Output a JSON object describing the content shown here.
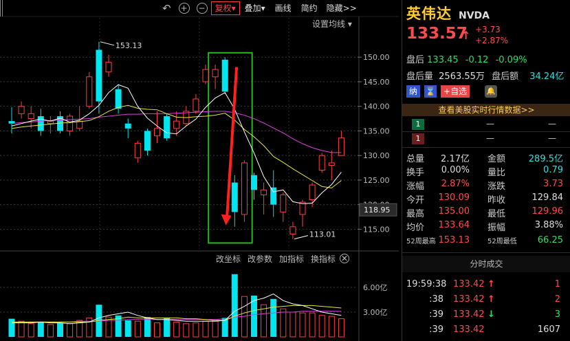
{
  "toolbar": {
    "undo_icon": "undo-icon",
    "zoom_in_icon": "plus-icon",
    "zoom_out_icon": "minus-icon",
    "fuquan": "复权▾",
    "diejia": "叠加▾",
    "huaxian": "画线",
    "jianyue": "简约",
    "yincang": "隐藏>>"
  },
  "ma_setting": "设置均线 ▾",
  "annotations": {
    "high": "153.13",
    "low": "113.01"
  },
  "y_axis": {
    "ticks": [
      {
        "label": "150.00",
        "value": 150
      },
      {
        "label": "145.00",
        "value": 145
      },
      {
        "label": "140.00",
        "value": 140
      },
      {
        "label": "135.00",
        "value": 135
      },
      {
        "label": "130.00",
        "value": 130
      },
      {
        "label": "125.00",
        "value": 125
      },
      {
        "label": "120.00",
        "value": 120
      },
      {
        "label": "115.00",
        "value": 115
      }
    ],
    "current_marker": "118.95"
  },
  "volume_axis": {
    "ticks": [
      {
        "label": "6.00亿",
        "value": 6
      },
      {
        "label": "3.00亿",
        "value": 3
      }
    ]
  },
  "sub_toolbar": {
    "gai_zuobiao": "改坐标",
    "gai_canshu": "改参数",
    "jia_zhibiao": "加指标",
    "huan_zhibiao": "换指标"
  },
  "chart_data": {
    "type": "candlestick",
    "ylim": [
      111,
      158
    ],
    "volume_ylim": [
      0,
      8.5
    ],
    "colors": {
      "up": "#ff4040",
      "down": "#00e5ee",
      "ma5": "#ffffff",
      "ma10": "#e8e838",
      "ma20": "#e040e0",
      "highlight": "#22bb22",
      "arrow": "#ff2020"
    },
    "candles": [
      {
        "o": 137.0,
        "h": 139.8,
        "l": 134.5,
        "c": 136.5,
        "v": 2.2
      },
      {
        "o": 138.5,
        "h": 141.0,
        "l": 137.5,
        "c": 140.0,
        "v": 1.9
      },
      {
        "o": 137.5,
        "h": 140.0,
        "l": 135.5,
        "c": 138.5,
        "v": 1.6
      },
      {
        "o": 138.0,
        "h": 139.5,
        "l": 134.0,
        "c": 135.0,
        "v": 1.8
      },
      {
        "o": 136.5,
        "h": 138.0,
        "l": 134.5,
        "c": 137.0,
        "v": 1.5
      },
      {
        "o": 138.0,
        "h": 139.0,
        "l": 134.5,
        "c": 135.0,
        "v": 1.7
      },
      {
        "o": 135.0,
        "h": 138.5,
        "l": 134.0,
        "c": 138.0,
        "v": 1.6
      },
      {
        "o": 135.5,
        "h": 140.0,
        "l": 135.0,
        "c": 137.0,
        "v": 2.0
      },
      {
        "o": 140.0,
        "h": 147.0,
        "l": 139.5,
        "c": 146.0,
        "v": 2.3
      },
      {
        "o": 151.5,
        "h": 153.13,
        "l": 138.5,
        "c": 141.0,
        "v": 3.9
      },
      {
        "o": 147.0,
        "h": 150.5,
        "l": 146.0,
        "c": 149.0,
        "v": 2.4
      },
      {
        "o": 143.5,
        "h": 144.5,
        "l": 138.5,
        "c": 139.5,
        "v": 2.6
      },
      {
        "o": 136.5,
        "h": 137.5,
        "l": 133.5,
        "c": 135.5,
        "v": 2.0
      },
      {
        "o": 129.5,
        "h": 133.0,
        "l": 128.5,
        "c": 132.5,
        "v": 1.9
      },
      {
        "o": 135.0,
        "h": 135.5,
        "l": 130.0,
        "c": 131.0,
        "v": 2.4
      },
      {
        "o": 134.0,
        "h": 139.0,
        "l": 132.5,
        "c": 135.5,
        "v": 1.7
      },
      {
        "o": 138.0,
        "h": 138.5,
        "l": 133.0,
        "c": 133.5,
        "v": 2.3
      },
      {
        "o": 135.5,
        "h": 139.0,
        "l": 134.0,
        "c": 137.0,
        "v": 1.8
      },
      {
        "o": 136.5,
        "h": 140.0,
        "l": 136.0,
        "c": 139.0,
        "v": 1.6
      },
      {
        "o": 139.0,
        "h": 142.5,
        "l": 138.5,
        "c": 141.5,
        "v": 1.7
      },
      {
        "o": 145.0,
        "h": 148.5,
        "l": 144.5,
        "c": 147.5,
        "v": 1.9
      },
      {
        "o": 146.0,
        "h": 148.5,
        "l": 143.5,
        "c": 147.5,
        "v": 2.0
      },
      {
        "o": 149.5,
        "h": 150.0,
        "l": 142.5,
        "c": 143.0,
        "v": 2.3
      },
      {
        "o": 124.5,
        "h": 126.0,
        "l": 115.5,
        "c": 118.5,
        "v": 7.6
      },
      {
        "o": 118.0,
        "h": 129.0,
        "l": 116.5,
        "c": 128.5,
        "v": 4.9
      },
      {
        "o": 126.0,
        "h": 126.5,
        "l": 121.0,
        "c": 123.0,
        "v": 5.0
      },
      {
        "o": 122.0,
        "h": 124.5,
        "l": 118.0,
        "c": 123.0,
        "v": 3.9
      },
      {
        "o": 123.5,
        "h": 127.0,
        "l": 117.5,
        "c": 120.0,
        "v": 4.6
      },
      {
        "o": 118.5,
        "h": 122.5,
        "l": 116.5,
        "c": 122.0,
        "v": 3.4
      },
      {
        "o": 114.0,
        "h": 116.5,
        "l": 113.01,
        "c": 115.5,
        "v": 3.0
      },
      {
        "o": 118.0,
        "h": 121.0,
        "l": 115.5,
        "c": 120.5,
        "v": 2.9
      },
      {
        "o": 121.0,
        "h": 124.5,
        "l": 119.5,
        "c": 124.0,
        "v": 2.9
      },
      {
        "o": 127.0,
        "h": 130.5,
        "l": 126.5,
        "c": 130.0,
        "v": 2.6
      },
      {
        "o": 128.0,
        "h": 131.0,
        "l": 125.0,
        "c": 128.5,
        "v": 2.5
      },
      {
        "o": 130.0,
        "h": 135.0,
        "l": 129.96,
        "c": 133.57,
        "v": 2.2
      }
    ],
    "ma5": [
      136.0,
      136.5,
      137.0,
      137.4,
      137.0,
      137.6,
      136.8,
      137.2,
      138.5,
      140.2,
      142.8,
      144.4,
      143.7,
      140.0,
      137.6,
      136.0,
      134.6,
      134.4,
      136.0,
      137.4,
      139.8,
      141.7,
      142.8,
      139.4,
      134.8,
      130.5,
      125.7,
      122.6,
      123.0,
      120.6,
      120.2,
      120.3,
      122.4,
      124.1,
      126.6
    ],
    "ma10": [
      135.5,
      135.8,
      136.0,
      136.2,
      136.4,
      136.6,
      136.7,
      136.9,
      137.1,
      137.9,
      139.0,
      139.8,
      140.2,
      139.6,
      139.4,
      139.3,
      138.5,
      137.8,
      137.7,
      137.9,
      138.0,
      138.2,
      138.6,
      137.2,
      135.3,
      133.8,
      132.0,
      129.8,
      128.6,
      127.3,
      126.1,
      124.9,
      123.7,
      123.4,
      124.9
    ],
    "ma20": [
      136.5,
      136.7,
      136.8,
      137.0,
      137.1,
      137.2,
      137.3,
      137.4,
      137.5,
      137.8,
      138.0,
      138.2,
      138.4,
      138.4,
      138.5,
      138.5,
      138.5,
      138.6,
      138.7,
      138.8,
      138.9,
      139.0,
      139.0,
      138.7,
      138.2,
      137.5,
      136.6,
      135.6,
      134.6,
      133.4,
      132.4,
      131.6,
      131.0,
      130.6,
      130.6
    ],
    "vma5": [
      1.7,
      1.7,
      1.7,
      1.8,
      1.7,
      1.7,
      1.6,
      1.7,
      1.8,
      2.3,
      2.6,
      2.8,
      3.0,
      2.6,
      2.3,
      2.1,
      2.1,
      2.0,
      1.9,
      1.9,
      1.9,
      1.9,
      2.0,
      3.1,
      3.7,
      4.4,
      4.7,
      5.2,
      4.4,
      4.0,
      3.8,
      3.4,
      3.0,
      2.8,
      2.6
    ],
    "vma10": [
      1.8,
      1.8,
      1.8,
      1.8,
      1.8,
      1.8,
      1.8,
      1.8,
      1.8,
      2.0,
      2.1,
      2.2,
      2.4,
      2.3,
      2.3,
      2.3,
      2.3,
      2.3,
      2.2,
      2.2,
      2.1,
      2.0,
      2.0,
      2.5,
      2.9,
      3.2,
      3.4,
      3.6,
      3.7,
      3.8,
      3.8,
      3.8,
      3.7,
      3.6,
      3.5
    ],
    "vma20": [
      1.8,
      1.8,
      1.8,
      1.8,
      1.8,
      1.8,
      1.8,
      1.9,
      1.9,
      1.9,
      2.0,
      2.0,
      2.1,
      2.1,
      2.1,
      2.1,
      2.1,
      2.1,
      2.1,
      2.1,
      2.1,
      2.1,
      2.2,
      2.4,
      2.5,
      2.7,
      2.8,
      2.9,
      3.0,
      3.0,
      3.1,
      3.1,
      3.1,
      3.1,
      3.1
    ]
  },
  "quote": {
    "name_cn": "英伟达",
    "ticker": "NVDA",
    "price": "133.57",
    "price_arrow": "↑",
    "change": "+3.73",
    "change_pct": "+2.87%",
    "after_label": "盘后",
    "after_price": "133.45",
    "after_change": "-0.12",
    "after_pct": "-0.09%",
    "after_vol_label": "盘后量",
    "after_vol": "2563.55万",
    "after_amt_label": "盘后额",
    "after_amt": "34.24亿",
    "btn_na": "纳",
    "btn_hourglass": "⌛",
    "btn_add": "+自选",
    "bell_icon": "bell-icon",
    "banner": "查看美股实时行情数据>>",
    "level_sell": "1",
    "level_buy": "1",
    "dash": "—",
    "stats": [
      {
        "l1": "总量",
        "v1": "2.17亿",
        "c1": "w",
        "l2": "金额",
        "v2": "289.5亿",
        "c2": "c"
      },
      {
        "l1": "换手",
        "v1": "0.00%",
        "c1": "w",
        "l2": "量比",
        "v2": "0.79",
        "c2": "c"
      },
      {
        "l1": "涨幅",
        "v1": "2.87%",
        "c1": "r",
        "l2": "涨跌",
        "v2": "3.73",
        "c2": "r"
      },
      {
        "l1": "今开",
        "v1": "130.09",
        "c1": "r",
        "l2": "昨收",
        "v2": "129.84",
        "c2": "w"
      },
      {
        "l1": "最高",
        "v1": "135.00",
        "c1": "r",
        "l2": "最低",
        "v2": "129.96",
        "c2": "r"
      },
      {
        "l1": "均价",
        "v1": "133.64",
        "c1": "r",
        "l2": "振幅",
        "v2": "3.88%",
        "c2": "w"
      },
      {
        "l1": "52周最高",
        "v1": "153.13",
        "c1": "r",
        "l2": "52周最低",
        "v2": "66.25",
        "c2": "g"
      }
    ],
    "tick_title": "分时成交",
    "ticks": [
      {
        "time": "19:59:38",
        "price": "133.42",
        "dir": "↑",
        "dc": "r",
        "vol": "1",
        "vc": "r"
      },
      {
        "time": ":38",
        "price": "133.42",
        "dir": "↑",
        "dc": "r",
        "vol": "2",
        "vc": "r"
      },
      {
        "time": ":39",
        "price": "133.42",
        "dir": "↓",
        "dc": "g",
        "vol": "3",
        "vc": "g"
      },
      {
        "time": ":39",
        "price": "133.42",
        "dir": "",
        "dc": "r",
        "vol": "1607",
        "vc": "w"
      }
    ]
  }
}
